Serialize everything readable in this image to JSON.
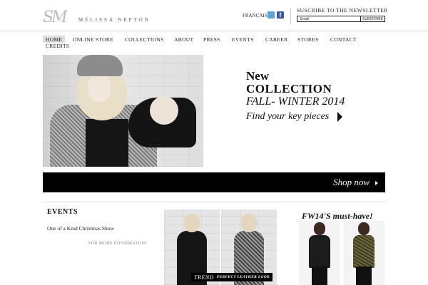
{
  "header": {
    "logo_monogram": "SM",
    "brand_name": "MÉLISSA NEPTON",
    "language_link": "FRANÇAIS",
    "social": {
      "facebook_glyph": "f",
      "twitter_icon": "twitter-icon",
      "facebook_icon": "facebook-icon"
    },
    "newsletter": {
      "title": "SUSCRIBE TO THE NEWSLETTER",
      "email_value": "Email",
      "button_label": "SUBSCRIBE"
    }
  },
  "nav": {
    "items": [
      {
        "label": "HOME",
        "active": true
      },
      {
        "label": "ONLINE STORE"
      },
      {
        "label": "COLLECTIONS"
      },
      {
        "label": "ABOUT"
      },
      {
        "label": "PRESS"
      },
      {
        "label": "EVENTS"
      },
      {
        "label": "CAREER"
      },
      {
        "label": "STORES"
      },
      {
        "label": "CONTACT"
      },
      {
        "label": "CREDITS"
      }
    ]
  },
  "hero": {
    "line1": "New",
    "line2": "COLLECTION",
    "line3": "FALL- WINTER 2014",
    "line4": "Find your key pieces",
    "shop_now": "Shop now"
  },
  "events": {
    "title": "EVENTS",
    "item": "One of a Kind Christmas Show",
    "more_link": "FOR MORE INFORMATION"
  },
  "trend": {
    "word": "TREND",
    "subtitle": "PERFECT LEATHER LOOK"
  },
  "musthave": {
    "title": "FW14'S must-have!"
  },
  "colors": {
    "accent_black": "#000000",
    "twitter_blue": "#5aa6d6",
    "facebook_blue": "#3b5998",
    "nav_active_bg": "#dddddd"
  }
}
